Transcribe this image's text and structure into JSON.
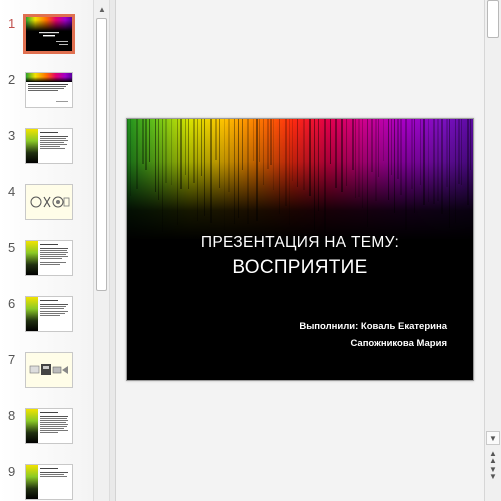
{
  "thumbnails": [
    {
      "num": "1",
      "kind": "title"
    },
    {
      "num": "2",
      "kind": "text-band"
    },
    {
      "num": "3",
      "kind": "left-rainbow"
    },
    {
      "num": "4",
      "kind": "illustration"
    },
    {
      "num": "5",
      "kind": "left-rainbow"
    },
    {
      "num": "6",
      "kind": "left-rainbow"
    },
    {
      "num": "7",
      "kind": "diagram"
    },
    {
      "num": "8",
      "kind": "left-rainbow"
    },
    {
      "num": "9",
      "kind": "left-rainbow"
    }
  ],
  "slide": {
    "title_line1": "ПРЕЗЕНТАЦИЯ НА ТЕМУ:",
    "title_line2": "ВОСПРИЯТИЕ",
    "author_line1": "Выполнили: Коваль Екатерина",
    "author_line2": "Сапожникова Мария"
  },
  "icons": {
    "scroll_up": "triangle-up-icon",
    "scroll_down": "triangle-down-icon",
    "prev_slide": "double-chevron-up-icon",
    "next_slide": "double-chevron-down-icon"
  },
  "colors": {
    "active_thumb_border": "#e07050",
    "slide_background": "#000000",
    "slide_text": "#ffffff"
  }
}
